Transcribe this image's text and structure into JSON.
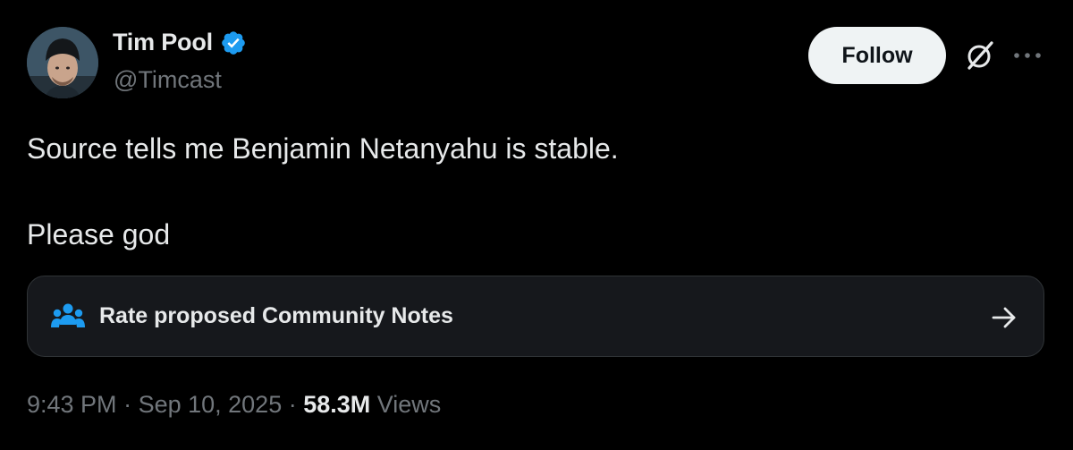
{
  "author": {
    "display_name": "Tim Pool",
    "handle": "@Timcast",
    "verified": true,
    "avatar_icon": "profile-photo"
  },
  "actions": {
    "follow_label": "Follow",
    "grok_icon": "grok-icon",
    "more_icon": "more-horizontal-icon"
  },
  "tweet": {
    "lines": [
      "Source tells me Benjamin Netanyahu is stable.",
      "",
      "Please god"
    ]
  },
  "community_notes": {
    "label": "Rate proposed Community Notes",
    "icon": "people-icon",
    "arrow_icon": "arrow-right-icon"
  },
  "meta": {
    "time": "9:43 PM",
    "separator": " · ",
    "date": "Sep 10, 2025",
    "views_count": "58.3M",
    "views_label": " Views"
  },
  "colors": {
    "background": "#000000",
    "text": "#e7e9ea",
    "secondary_text": "#71767b",
    "verified_blue": "#1d9bf0",
    "card_background": "#16181c",
    "follow_button_bg": "#eff3f4"
  }
}
